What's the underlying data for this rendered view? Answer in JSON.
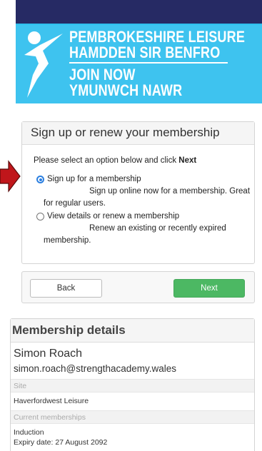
{
  "banner": {
    "line1": "PEMBROKESHIRE LEISURE",
    "line2": "HAMDDEN SIR BENFRO",
    "line3": "JOIN NOW",
    "line4": "YMUNWCH NAWR"
  },
  "signup": {
    "title": "Sign up or renew your membership",
    "intro_prefix": "Please select an option below and click ",
    "intro_bold": "Next",
    "options": [
      {
        "label": "Sign up for a membership",
        "description": "Sign up online now for a membership. Great for regular users.",
        "selected": true
      },
      {
        "label": "View details or renew a membership",
        "description": "Renew an existing or recently expired membership.",
        "selected": false
      }
    ]
  },
  "nav": {
    "back_label": "Back",
    "next_label": "Next"
  },
  "details": {
    "title": "Membership details",
    "name": "Simon Roach",
    "email": "simon.roach@strengthacademy.wales",
    "site_label": "Site",
    "site_value": "Haverfordwest Leisure",
    "current_label": "Current memberships",
    "membership_name": "Induction",
    "membership_expiry": "Expiry date: 27 August 2092"
  },
  "colors": {
    "topbar": "#262a64",
    "hero": "#3ec3ef",
    "next_button": "#4cb863",
    "radio_selected": "#2b7fe0",
    "arrow": "#c0161b"
  }
}
